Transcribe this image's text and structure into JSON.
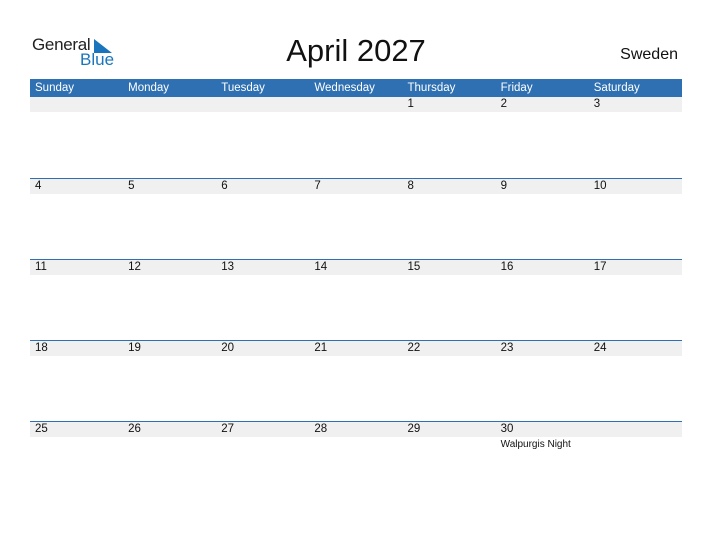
{
  "logo": {
    "part1": "General",
    "part2": "Blue"
  },
  "title": "April 2027",
  "country": "Sweden",
  "colors": {
    "accent": "#2e70b1",
    "date_strip": "#f0f0f0"
  },
  "weekdays": [
    "Sunday",
    "Monday",
    "Tuesday",
    "Wednesday",
    "Thursday",
    "Friday",
    "Saturday"
  ],
  "weeks": [
    [
      {
        "d": ""
      },
      {
        "d": ""
      },
      {
        "d": ""
      },
      {
        "d": ""
      },
      {
        "d": "1"
      },
      {
        "d": "2"
      },
      {
        "d": "3"
      }
    ],
    [
      {
        "d": "4"
      },
      {
        "d": "5"
      },
      {
        "d": "6"
      },
      {
        "d": "7"
      },
      {
        "d": "8"
      },
      {
        "d": "9"
      },
      {
        "d": "10"
      }
    ],
    [
      {
        "d": "11"
      },
      {
        "d": "12"
      },
      {
        "d": "13"
      },
      {
        "d": "14"
      },
      {
        "d": "15"
      },
      {
        "d": "16"
      },
      {
        "d": "17"
      }
    ],
    [
      {
        "d": "18"
      },
      {
        "d": "19"
      },
      {
        "d": "20"
      },
      {
        "d": "21"
      },
      {
        "d": "22"
      },
      {
        "d": "23"
      },
      {
        "d": "24"
      }
    ],
    [
      {
        "d": "25"
      },
      {
        "d": "26"
      },
      {
        "d": "27"
      },
      {
        "d": "28"
      },
      {
        "d": "29"
      },
      {
        "d": "30",
        "event": "Walpurgis Night"
      },
      {
        "d": ""
      }
    ]
  ]
}
